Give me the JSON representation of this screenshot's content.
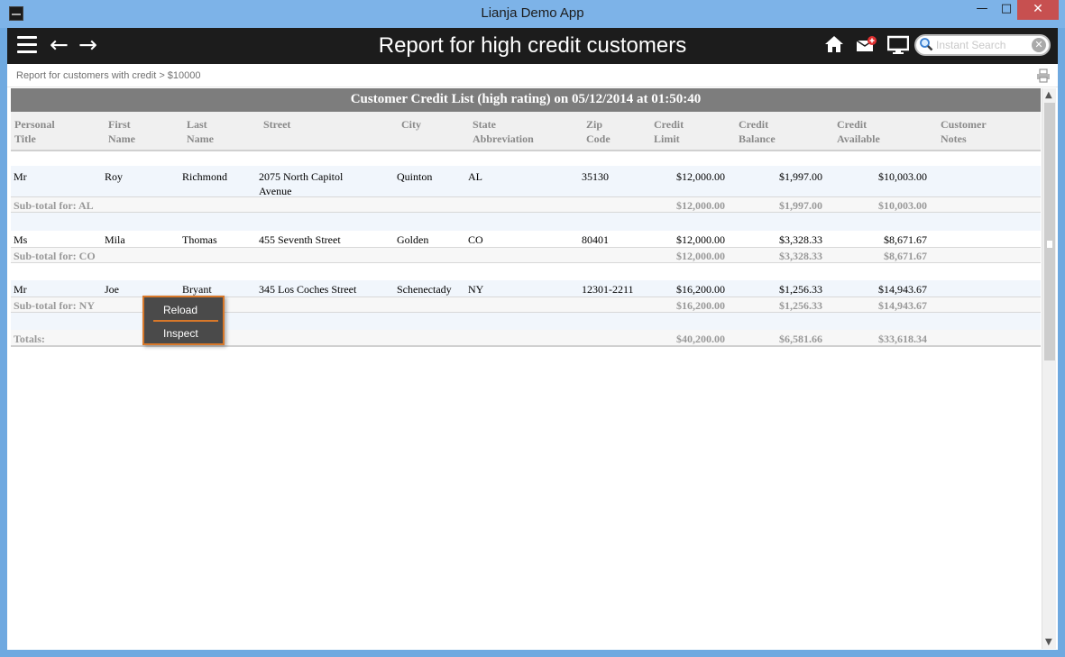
{
  "window": {
    "title": "Lianja Demo App",
    "minimize": "—",
    "maximize": "□",
    "close": "✕"
  },
  "header": {
    "title": "Report for high credit customers",
    "search_placeholder": "Instant Search",
    "back": "←",
    "forward": "→"
  },
  "breadcrumb": "Report for customers with credit > $10000",
  "report": {
    "title": "Customer Credit List (high rating) on 05/12/2014 at 01:50:40",
    "columns": [
      {
        "line1": "Personal",
        "line2": "Title"
      },
      {
        "line1": "First",
        "line2": "Name"
      },
      {
        "line1": "Last",
        "line2": "Name"
      },
      {
        "line1": "Street",
        "line2": ""
      },
      {
        "line1": "City",
        "line2": ""
      },
      {
        "line1": "State",
        "line2": "Abbreviation"
      },
      {
        "line1": "Zip",
        "line2": "Code"
      },
      {
        "line1": "Credit",
        "line2": "Limit"
      },
      {
        "line1": "Credit",
        "line2": "Balance"
      },
      {
        "line1": "Credit",
        "line2": "Available"
      },
      {
        "line1": "Customer",
        "line2": "Notes"
      }
    ],
    "groups": [
      {
        "row": {
          "title": "Mr",
          "first": "Roy",
          "last": "Richmond",
          "street": "2075 North Capitol",
          "street2": "Avenue",
          "city": "Quinton",
          "state": "AL",
          "zip": "35130",
          "limit": "$12,000.00",
          "balance": "$1,997.00",
          "available": "$10,003.00"
        },
        "subtotal": {
          "label": "Sub-total for: AL",
          "limit": "$12,000.00",
          "balance": "$1,997.00",
          "available": "$10,003.00"
        }
      },
      {
        "row": {
          "title": "Ms",
          "first": "Mila",
          "last": "Thomas",
          "street": "455 Seventh Street",
          "street2": "",
          "city": "Golden",
          "state": "CO",
          "zip": "80401",
          "limit": "$12,000.00",
          "balance": "$3,328.33",
          "available": "$8,671.67"
        },
        "subtotal": {
          "label": "Sub-total for: CO",
          "limit": "$12,000.00",
          "balance": "$3,328.33",
          "available": "$8,671.67"
        }
      },
      {
        "row": {
          "title": "Mr",
          "first": "Joe",
          "last": "Bryant",
          "street": "345 Los Coches Street",
          "street2": "",
          "city": "Schenectady",
          "state": "NY",
          "zip": "12301-2211",
          "limit": "$16,200.00",
          "balance": "$1,256.33",
          "available": "$14,943.67"
        },
        "subtotal": {
          "label": "Sub-total for: NY",
          "limit": "$16,200.00",
          "balance": "$1,256.33",
          "available": "$14,943.67"
        }
      }
    ],
    "totals": {
      "label": "Totals:",
      "limit": "$40,200.00",
      "balance": "$6,581.66",
      "available": "$33,618.34"
    }
  },
  "context_menu": {
    "items": [
      "Reload",
      "Inspect"
    ]
  },
  "colors": {
    "header_bg": "#1c1c1c",
    "report_title_bg": "#7d7d7d",
    "menu_accent": "#d8782a",
    "close_button": "#c75050"
  }
}
